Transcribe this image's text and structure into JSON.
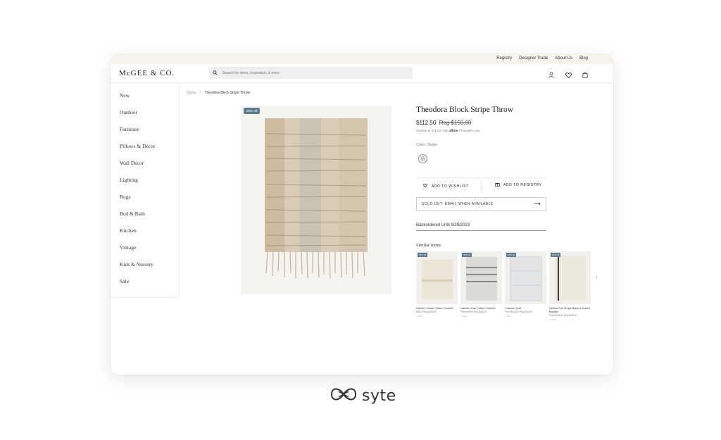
{
  "topbar": {
    "links": [
      "Registry",
      "Designer Trade",
      "About Us",
      "Blog"
    ]
  },
  "header": {
    "logo": "McGEE & CO.",
    "search_placeholder": "Search for items, inspiration, & more"
  },
  "sidebar": {
    "items": [
      "New",
      "Outdoor",
      "Furniture",
      "Pillows & Decor",
      "Wall Decor",
      "Lighting",
      "Rugs",
      "Bed & Bath",
      "Kitchen",
      "Vintage",
      "Kids & Nursery",
      "Sale"
    ]
  },
  "breadcrumb": {
    "home": "Home",
    "sep": "/",
    "current": "Theodora Block Stripe Throw"
  },
  "product": {
    "badge": "25% off",
    "title": "Theodora Block Stripe Throw",
    "price": "$112.50",
    "reg_price": "Reg $150.00",
    "affirm_prefix": "Starting at $11/mo with",
    "affirm_brand": "affirm",
    "affirm_link": "Prequalify now",
    "color_label": "Color: Beige",
    "swatch_color": "#d9c8b6",
    "wishlist_label": "ADD TO WISHLIST",
    "registry_label": "ADD TO REGISTRY",
    "soldout_label": "SOLD OUT: EMAIL WHEN AVAILABLE",
    "backorder": "Backordered Until 9/29/2023"
  },
  "similar": {
    "title": "Similar Items",
    "items": [
      {
        "badge": "25% off",
        "name": "Latham Cream Cotton Coverlet",
        "price": "$98.00 Reg $130.00",
        "swatches": "2 colors"
      },
      {
        "badge": "25% off",
        "name": "Latham Gray Cotton Coverlet",
        "price": "From $98.00 Reg $130.00",
        "swatches": "2 colors"
      },
      {
        "badge": "25% off",
        "name": "Chaucer Quilt",
        "price": "From $120.00 Reg $160.00",
        "swatches": "2 colors"
      },
      {
        "badge": "25% off",
        "name": "Helena Soft Fringe Black & Cream Blanket",
        "price": "From $105.00 Reg $140.00",
        "swatches": "2 colors"
      }
    ]
  },
  "brand": {
    "name": "syte"
  },
  "colors": {
    "accent_badge": "#5a7a8e",
    "topbar": "#f6f4ec"
  }
}
